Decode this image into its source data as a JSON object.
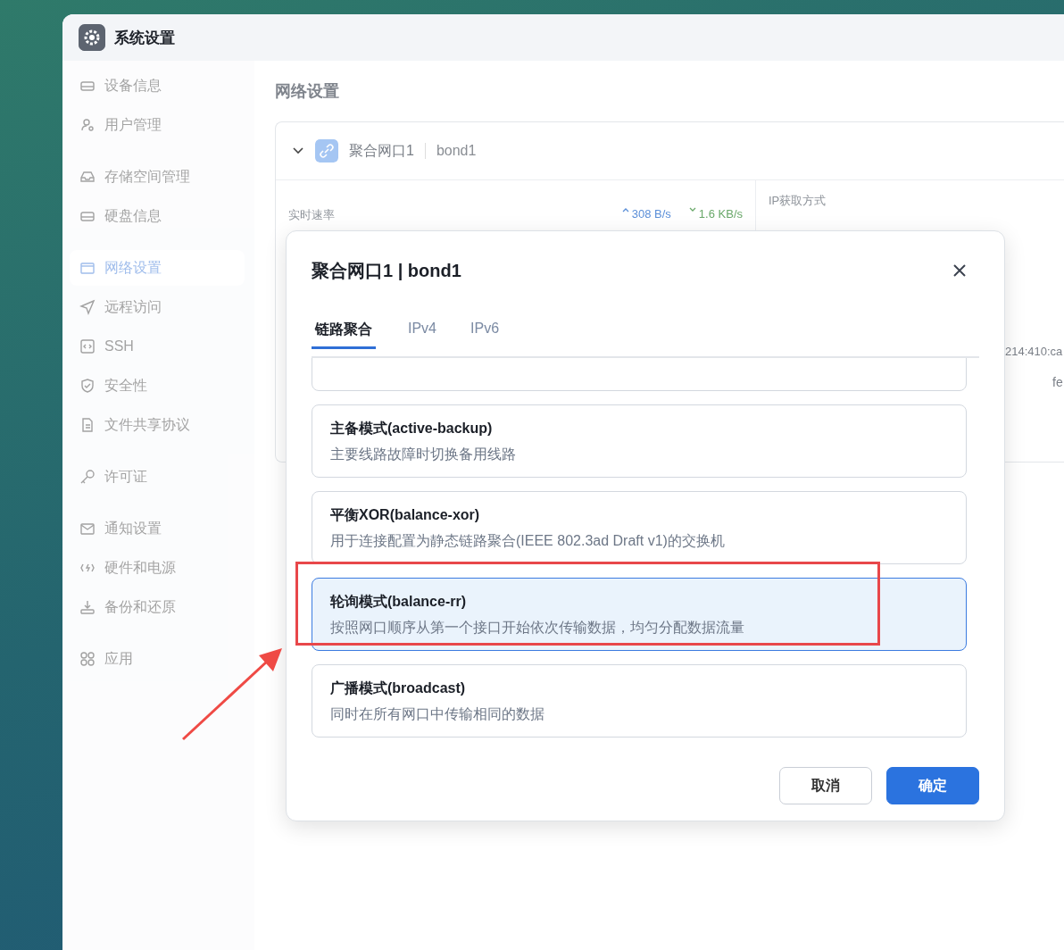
{
  "window": {
    "title": "系统设置"
  },
  "sidebar": {
    "groups": [
      {
        "items": [
          {
            "label": "设备信息",
            "selected": false
          },
          {
            "label": "用户管理",
            "selected": false
          }
        ]
      },
      {
        "items": [
          {
            "label": "存储空间管理",
            "selected": false
          },
          {
            "label": "硬盘信息",
            "selected": false
          }
        ]
      },
      {
        "items": [
          {
            "label": "网络设置",
            "selected": true
          },
          {
            "label": "远程访问",
            "selected": false
          },
          {
            "label": "SSH",
            "selected": false
          },
          {
            "label": "安全性",
            "selected": false
          },
          {
            "label": "文件共享协议",
            "selected": false
          }
        ]
      },
      {
        "items": [
          {
            "label": "许可证",
            "selected": false
          }
        ]
      },
      {
        "items": [
          {
            "label": "通知设置",
            "selected": false
          },
          {
            "label": "硬件和电源",
            "selected": false
          },
          {
            "label": "备份和还原",
            "selected": false
          }
        ]
      },
      {
        "items": [
          {
            "label": "应用",
            "selected": false
          }
        ]
      }
    ]
  },
  "page_title": "网络设置",
  "interface_card": {
    "expanded": true,
    "name": "聚合网口1",
    "device": "bond1",
    "speed_label": "实时速率",
    "upload": "308 B/s",
    "download": "1.6 KB/s",
    "ip_mode_label": "IP获取方式",
    "values": [
      "214:410:ca",
      "fe"
    ]
  },
  "dialog": {
    "title": "聚合网口1 | bond1",
    "tabs": [
      {
        "label": "链路聚合",
        "selected": true
      },
      {
        "label": "IPv4",
        "selected": false
      },
      {
        "label": "IPv6",
        "selected": false
      }
    ],
    "options": [
      {
        "kind": "clipped",
        "selected": false
      },
      {
        "kind": "mode",
        "name": "主备模式(active-backup)",
        "description": "主要线路故障时切换备用线路",
        "selected": false
      },
      {
        "kind": "mode",
        "name": "平衡XOR(balance-xor)",
        "description": "用于连接配置为静态链路聚合(IEEE 802.3ad Draft v1)的交换机",
        "selected": false
      },
      {
        "kind": "mode",
        "name": "轮询模式(balance-rr)",
        "description": "按照网口顺序从第一个接口开始依次传输数据，均匀分配数据流量",
        "selected": true
      },
      {
        "kind": "mode",
        "name": "广播模式(broadcast)",
        "description": "同时在所有网口中传输相同的数据",
        "selected": false
      }
    ],
    "buttons": [
      {
        "label": "取消",
        "kind": "secondary"
      },
      {
        "label": "确定",
        "kind": "primary"
      }
    ]
  }
}
